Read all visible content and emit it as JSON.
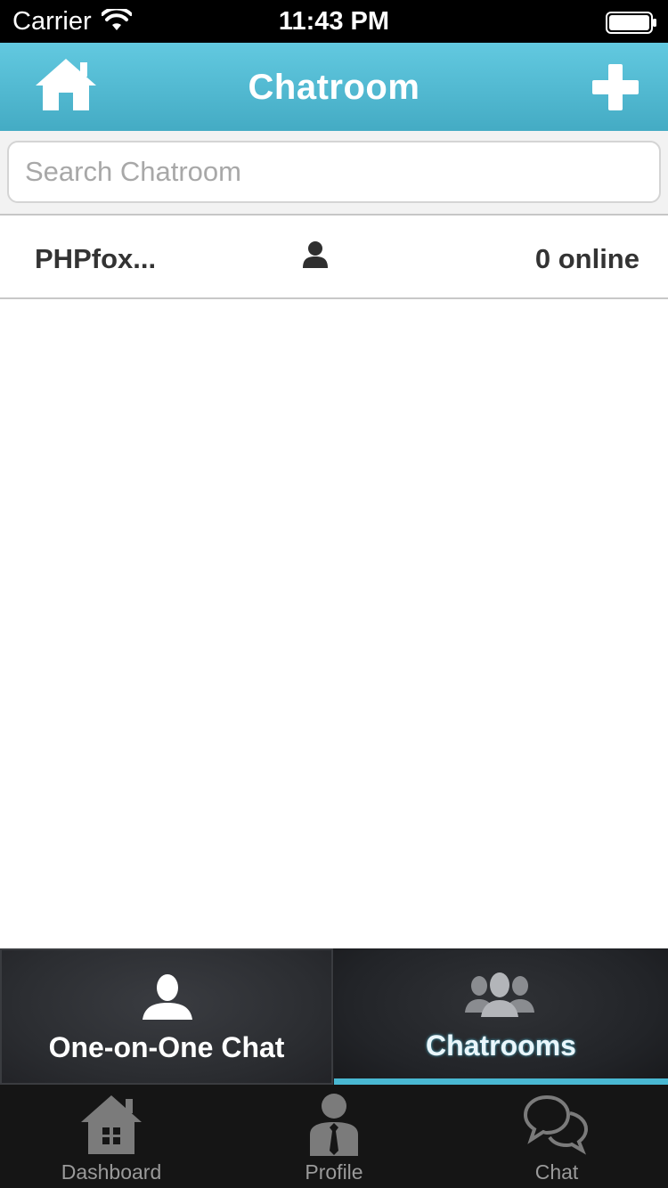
{
  "status_bar": {
    "carrier": "Carrier",
    "time": "11:43 PM"
  },
  "nav": {
    "title": "Chatroom",
    "left_icon": "home-icon",
    "right_icon": "plus-icon"
  },
  "search": {
    "placeholder": "Search Chatroom",
    "value": ""
  },
  "chatrooms": [
    {
      "name": "PHPfox...",
      "online": "0 online"
    }
  ],
  "segments": {
    "one_on_one": "One-on-One Chat",
    "chatrooms": "Chatrooms",
    "selected": "chatrooms"
  },
  "tab_bar": {
    "items": [
      {
        "label": "Dashboard",
        "icon": "house-icon"
      },
      {
        "label": "Profile",
        "icon": "person-tie-icon"
      },
      {
        "label": "Chat",
        "icon": "speech-bubbles-icon"
      }
    ]
  },
  "colors": {
    "accent": "#49b8d2",
    "nav_top": "#62c9e0",
    "nav_bottom": "#44abc4",
    "dark_bar": "#151515"
  }
}
